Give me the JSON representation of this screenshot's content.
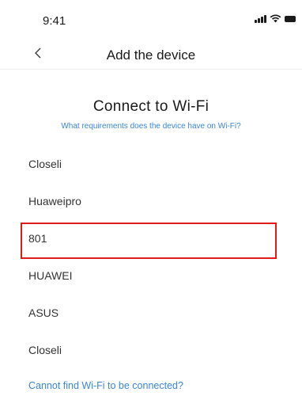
{
  "status_bar": {
    "time": "9:41",
    "icons": [
      "signal-icon",
      "wifi-icon",
      "battery-icon"
    ]
  },
  "nav": {
    "back_icon": "chevron-left-icon",
    "title": "Add the device"
  },
  "main": {
    "heading": "Connect to Wi-Fi",
    "requirements_link": "What requirements does the device have on Wi-Fi?",
    "networks": [
      {
        "name": "Closeli",
        "highlighted": false
      },
      {
        "name": "Huaweipro",
        "highlighted": false
      },
      {
        "name": "801",
        "highlighted": true
      },
      {
        "name": "HUAWEI",
        "highlighted": false
      },
      {
        "name": "ASUS",
        "highlighted": false
      },
      {
        "name": "Closeli",
        "highlighted": false
      }
    ],
    "cannot_find_link": "Cannot find Wi-Fi to be connected?"
  },
  "colors": {
    "link": "#3a86d6",
    "highlight_border": "#e01b1b"
  }
}
